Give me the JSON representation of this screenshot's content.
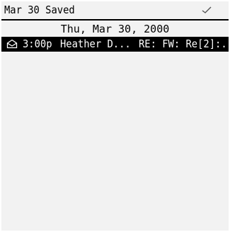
{
  "title_bar": {
    "text": "Mar 30 Saved",
    "status_icon": "check-icon"
  },
  "date_header": "Thu, Mar 30, 2000",
  "messages": [
    {
      "icon": "envelope-icon",
      "time": "3:00p",
      "sender": "Heather D...",
      "subject": "RE: FW: Re[2]:..",
      "selected": true
    }
  ],
  "colors": {
    "background": "#f2f2f2",
    "text": "#000000",
    "selection": "#000000",
    "selection_text": "#ffffff"
  }
}
